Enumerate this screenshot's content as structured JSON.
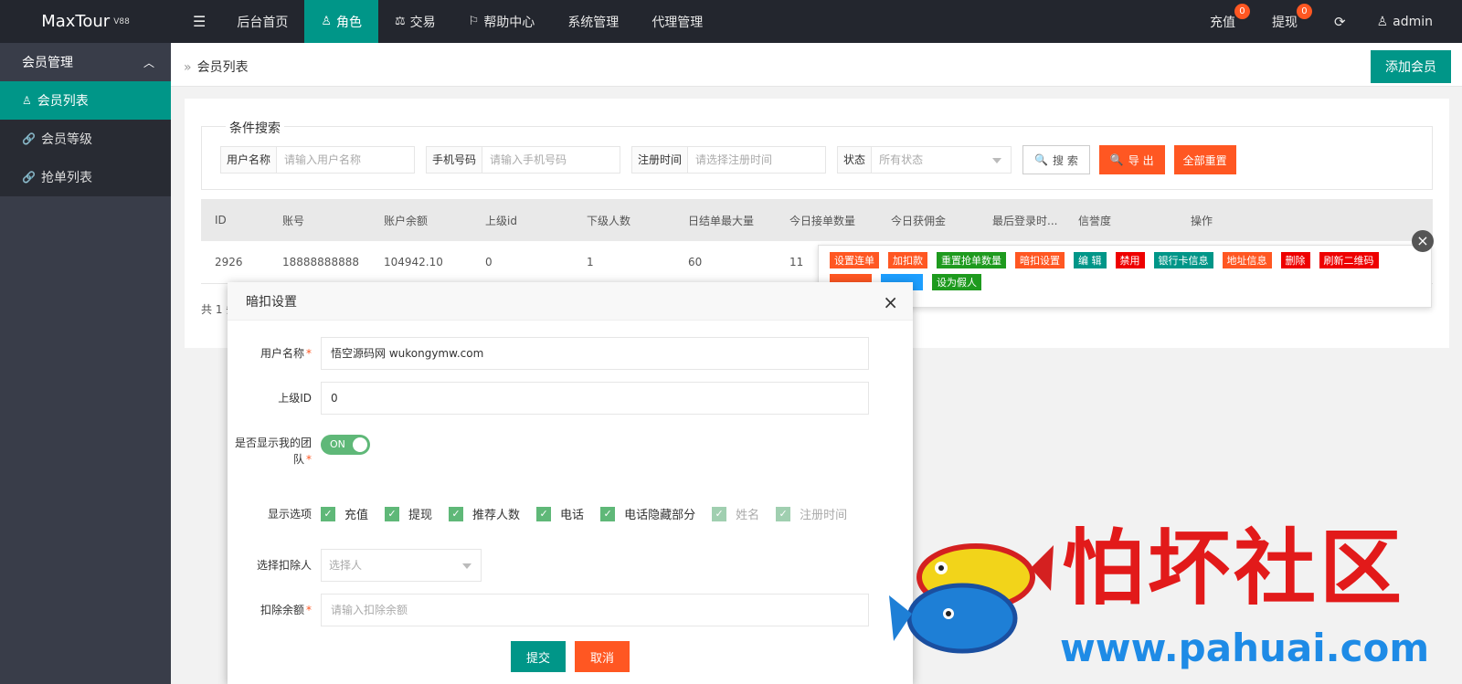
{
  "app": {
    "name": "MaxTour",
    "version": "V88"
  },
  "nav": {
    "items": [
      "后台首页",
      "角色",
      "交易",
      "帮助中心",
      "系统管理",
      "代理管理"
    ],
    "active": "角色"
  },
  "right_nav": {
    "recharge": "充值",
    "recharge_badge": "0",
    "withdraw": "提现",
    "withdraw_badge": "0",
    "user": "admin"
  },
  "sidebar": {
    "group": "会员管理",
    "items": [
      "会员列表",
      "会员等级",
      "抢单列表"
    ],
    "active": "会员列表"
  },
  "breadcrumb": "会员列表",
  "add_button": "添加会员",
  "search": {
    "legend": "条件搜索",
    "username_label": "用户名称",
    "username_placeholder": "请输入用户名称",
    "phone_label": "手机号码",
    "phone_placeholder": "请输入手机号码",
    "regtime_label": "注册时间",
    "regtime_placeholder": "请选择注册时间",
    "status_label": "状态",
    "status_value": "所有状态",
    "search_btn": "搜 索",
    "export_btn": "导 出",
    "reset_btn": "全部重置"
  },
  "table": {
    "headers": [
      "ID",
      "账号",
      "账户余额",
      "上级id",
      "下级人数",
      "日结单最大量",
      "今日接单数量",
      "今日获佣金",
      "最后登录时...",
      "信誉度",
      "操作"
    ],
    "rows": [
      [
        "2926",
        "18888888888",
        "104942.10",
        "0",
        "1",
        "60",
        "11"
      ]
    ],
    "pager": "共 1 条"
  },
  "ops": [
    {
      "label": "设置连单",
      "color": "orange"
    },
    {
      "label": "加扣款",
      "color": "orange"
    },
    {
      "label": "重置抢单数量",
      "color": "darkgreen"
    },
    {
      "label": "暗扣设置",
      "color": "orange"
    },
    {
      "label": "编 辑",
      "color": "green"
    },
    {
      "label": "禁用",
      "color": "red"
    },
    {
      "label": "银行卡信息",
      "color": "green"
    },
    {
      "label": "地址信息",
      "color": "orange"
    },
    {
      "label": "删除",
      "color": "red"
    },
    {
      "label": "刷新二维码",
      "color": "red"
    },
    {
      "label": "",
      "color": "orange"
    },
    {
      "label": "",
      "color": "blue"
    },
    {
      "label": "设为假人",
      "color": "darkgreen"
    }
  ],
  "modal": {
    "title": "暗扣设置",
    "username_label": "用户名称",
    "username_value": "悟空源码网 wukongymw.com",
    "parent_label": "上级ID",
    "parent_value": "0",
    "show_team_label": "是否显示我的团队",
    "show_team_value": "ON",
    "display_label": "显示选项",
    "display_options": [
      {
        "label": "充值",
        "checked": true
      },
      {
        "label": "提现",
        "checked": true
      },
      {
        "label": "推荐人数",
        "checked": true
      },
      {
        "label": "电话",
        "checked": true
      },
      {
        "label": "电话隐藏部分",
        "checked": true
      },
      {
        "label": "姓名",
        "checked": true,
        "disabled": true
      },
      {
        "label": "注册时间",
        "checked": true,
        "disabled": true
      }
    ],
    "deductor_label": "选择扣除人",
    "deductor_placeholder": "选择人",
    "amount_label": "扣除余额",
    "amount_placeholder": "请输入扣除余额",
    "submit": "提交",
    "cancel": "取消"
  },
  "watermark": {
    "text": "怕坏社区",
    "url": "www.pahuai.com"
  }
}
